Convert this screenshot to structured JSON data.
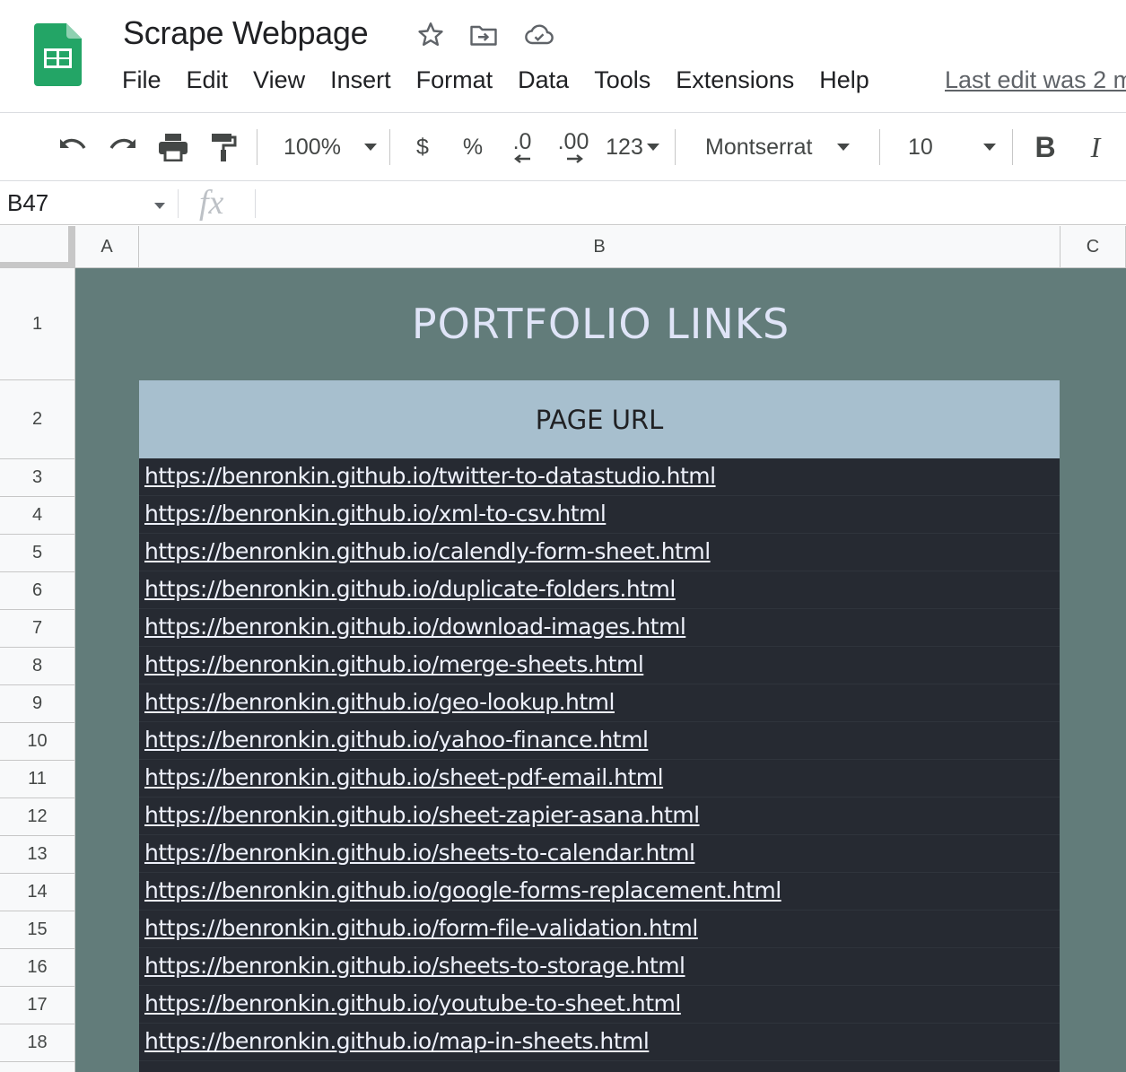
{
  "app": {
    "doc_title": "Scrape Webpage",
    "menu": [
      "File",
      "Edit",
      "View",
      "Insert",
      "Format",
      "Data",
      "Tools",
      "Extensions",
      "Help"
    ],
    "last_edit": "Last edit was 2 m"
  },
  "toolbar": {
    "zoom": "100%",
    "currency": "$",
    "percent": "%",
    "decrease_decimal": ".0",
    "increase_decimal": ".00",
    "more_formats": "123",
    "font": "Montserrat",
    "font_size": "10",
    "bold": "B",
    "italic": "I"
  },
  "formula_bar": {
    "name_box": "B47",
    "fx": "fx",
    "value": ""
  },
  "grid": {
    "columns": [
      "A",
      "B",
      "C"
    ],
    "rows": [
      "1",
      "2",
      "3",
      "4",
      "5",
      "6",
      "7",
      "8",
      "9",
      "10",
      "11",
      "12",
      "13",
      "14",
      "15",
      "16",
      "17",
      "18"
    ],
    "title": "PORTFOLIO LINKS",
    "header": "PAGE URL",
    "links": [
      "https://benronkin.github.io/twitter-to-datastudio.html",
      "https://benronkin.github.io/xml-to-csv.html",
      "https://benronkin.github.io/calendly-form-sheet.html",
      "https://benronkin.github.io/duplicate-folders.html",
      "https://benronkin.github.io/download-images.html",
      "https://benronkin.github.io/merge-sheets.html",
      "https://benronkin.github.io/geo-lookup.html",
      "https://benronkin.github.io/yahoo-finance.html",
      "https://benronkin.github.io/sheet-pdf-email.html",
      "https://benronkin.github.io/sheet-zapier-asana.html",
      "https://benronkin.github.io/sheets-to-calendar.html",
      "https://benronkin.github.io/google-forms-replacement.html",
      "https://benronkin.github.io/form-file-validation.html",
      "https://benronkin.github.io/sheets-to-storage.html",
      "https://benronkin.github.io/youtube-to-sheet.html",
      "https://benronkin.github.io/map-in-sheets.html"
    ]
  },
  "colors": {
    "sheet_background": "#627c7a",
    "title_text": "#dfe4f7",
    "header_fill": "#a7bfce",
    "data_fill": "#262a32",
    "link_text": "#eef1fb",
    "sheets_green": "#23a566"
  }
}
